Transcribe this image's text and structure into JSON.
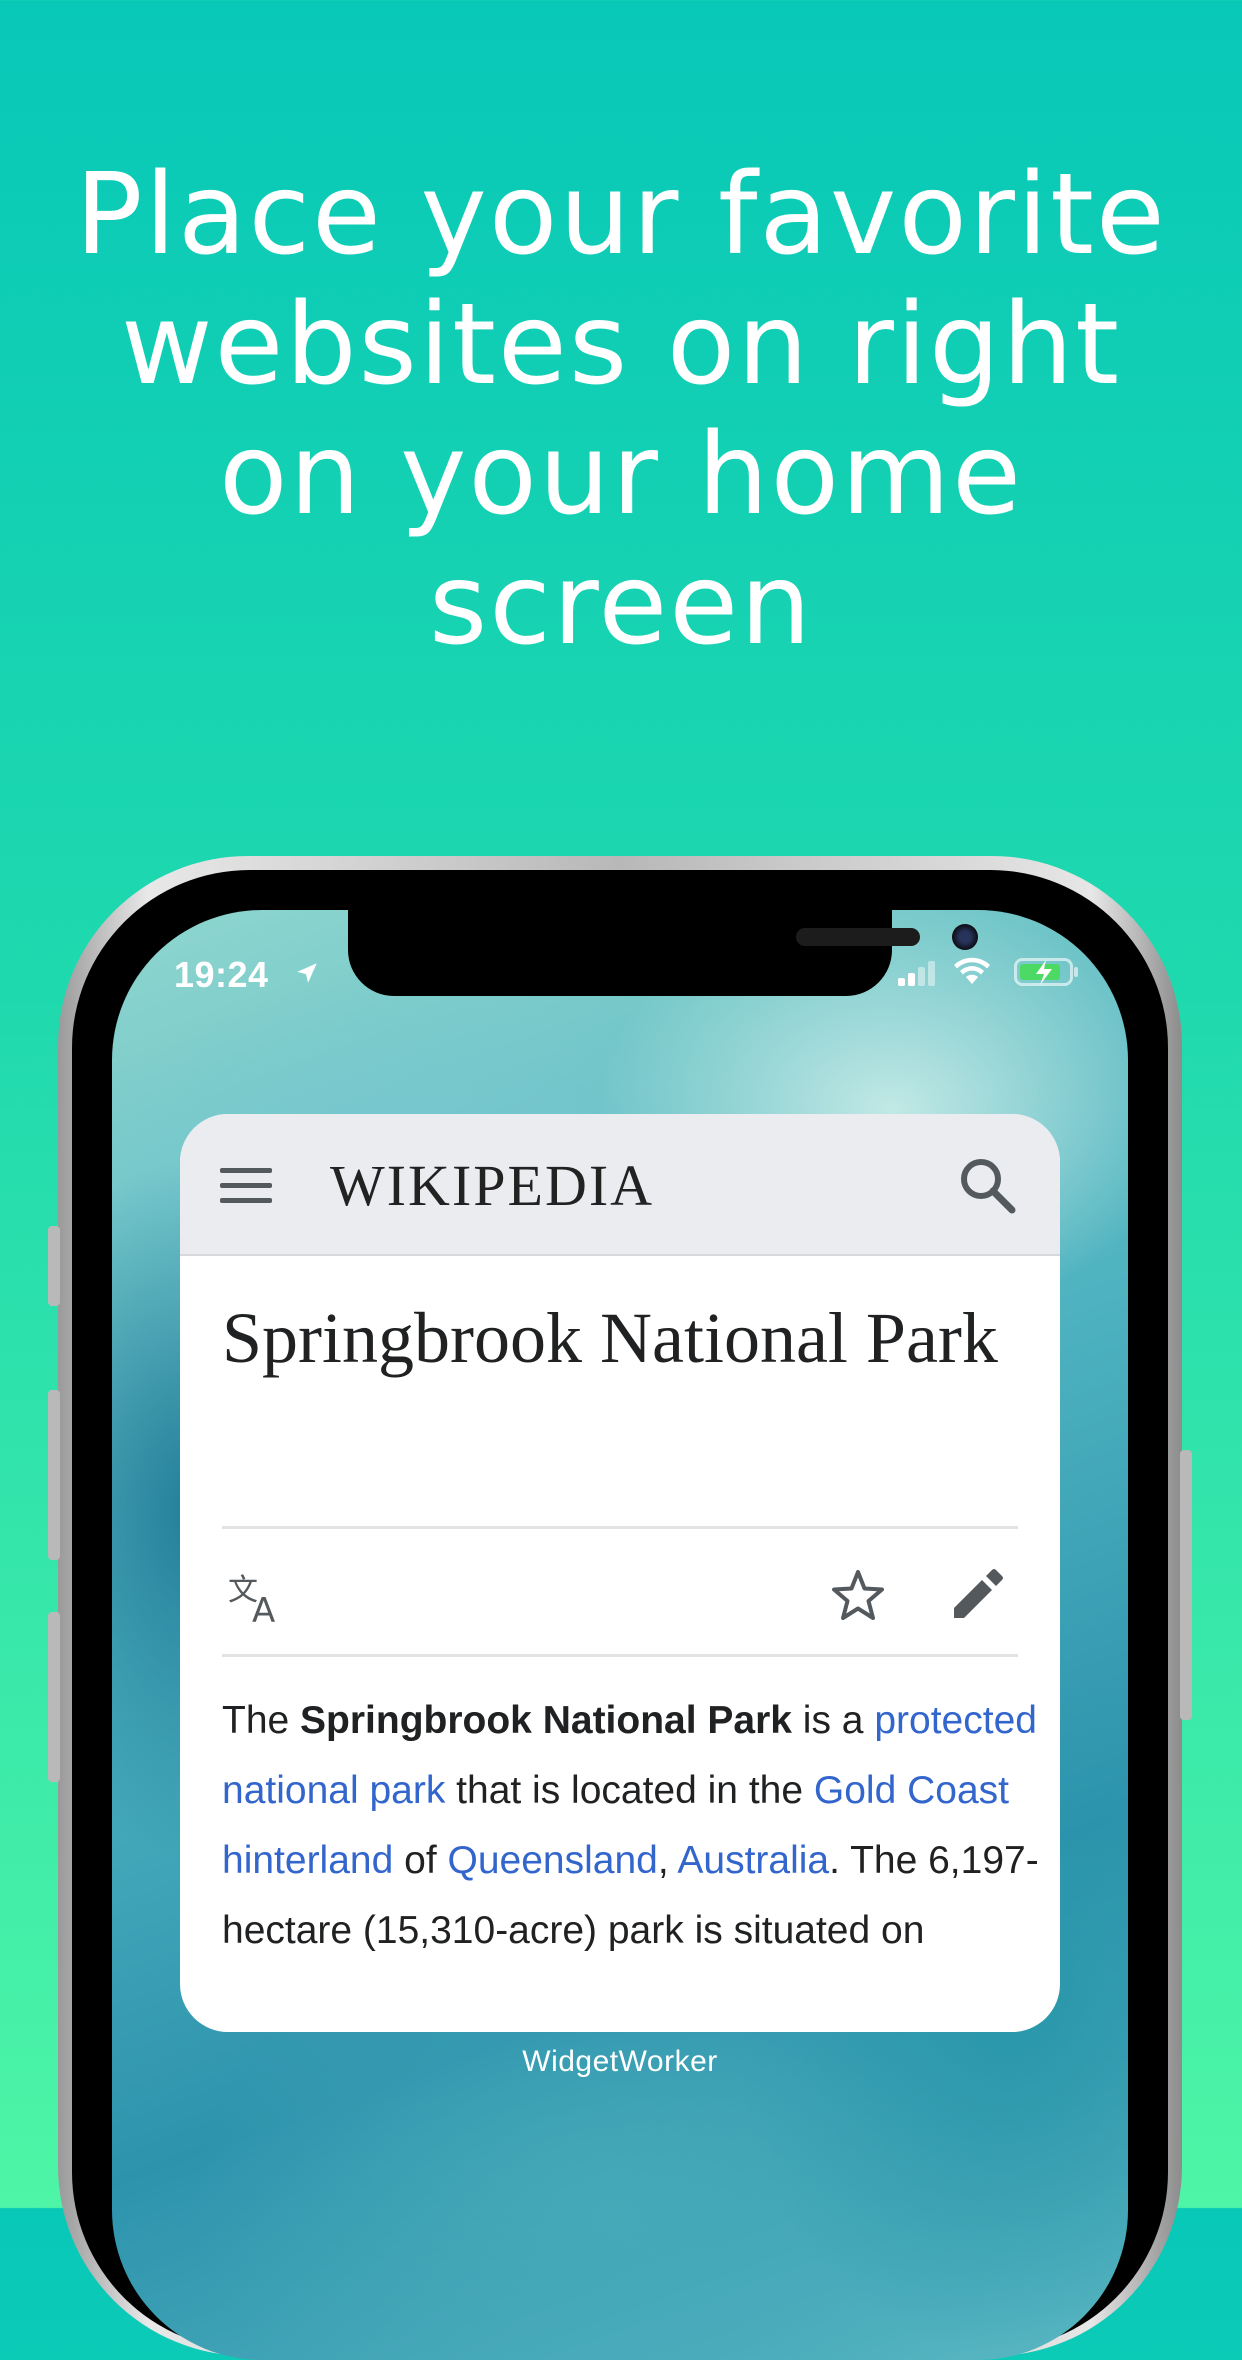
{
  "headline": {
    "lines": [
      "Place your favorite",
      "websites on right",
      "on your home",
      "screen"
    ]
  },
  "status_bar": {
    "time": "19:24",
    "icons": [
      "location-arrow-icon",
      "cellular-signal-icon",
      "wifi-icon",
      "battery-charging-icon"
    ]
  },
  "widget": {
    "site_name": "Wikipedia",
    "logo_text": "WIKIPEDIA",
    "article_title": "Springbrook National Park",
    "body": {
      "t1": "The ",
      "bold": "Springbrook National Park",
      "t2": " is a ",
      "link1": "protected national park",
      "t3": " that is located in the ",
      "link2": "Gold Coast hinterland",
      "t4": " of ",
      "link3": "Queensland",
      "t5": ", ",
      "link4": "Australia",
      "t6": ". The 6,197-hectare (15,310-acre) park is situated on"
    },
    "label": "WidgetWorker"
  },
  "colors": {
    "background_top": "#08c8b8",
    "background_bottom": "#4ef5a6",
    "link": "#3366cc",
    "header_bg": "#eaecf0"
  }
}
